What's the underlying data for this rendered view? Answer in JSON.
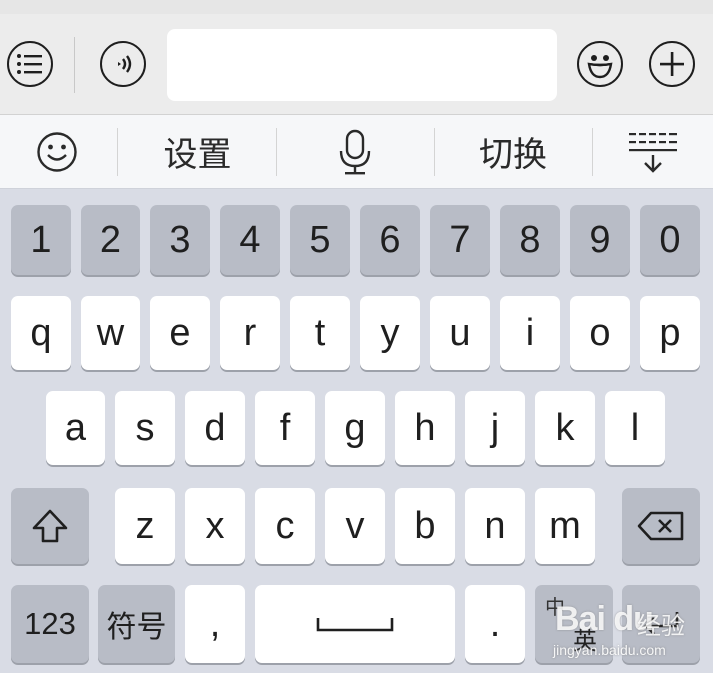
{
  "icons": {
    "menu": "list-icon",
    "voice": "voice-wave-icon",
    "emoji": "emoji-icon",
    "add": "plus-icon",
    "smiley": "smiley-icon",
    "mic": "microphone-icon",
    "collapse": "keyboard-collapse-icon",
    "shift": "shift-icon",
    "backspace": "backspace-icon",
    "enter": "enter-icon",
    "space": "space-bar-icon"
  },
  "chat": {
    "input_value": "",
    "input_placeholder": ""
  },
  "toolbar": {
    "settings": "设置",
    "switch": "切换"
  },
  "keys": {
    "numbers": [
      "1",
      "2",
      "3",
      "4",
      "5",
      "6",
      "7",
      "8",
      "9",
      "0"
    ],
    "row1": [
      "q",
      "w",
      "e",
      "r",
      "t",
      "y",
      "u",
      "i",
      "o",
      "p"
    ],
    "row2": [
      "a",
      "s",
      "d",
      "f",
      "g",
      "h",
      "j",
      "k",
      "l"
    ],
    "row3": [
      "z",
      "x",
      "c",
      "v",
      "b",
      "n",
      "m"
    ],
    "num_mode": "123",
    "symbols": "符号",
    "comma": ",",
    "period": ".",
    "lang_zh": "中",
    "lang_en": "英"
  },
  "watermark": {
    "logo": "Bai du",
    "cn": "经验",
    "url": "jingyan.baidu.com"
  },
  "colors": {
    "key_bg": "#ffffff",
    "key_dark": "#b8bcc6",
    "board_bg": "#d9dce5",
    "topbar_bg": "#ececec"
  }
}
